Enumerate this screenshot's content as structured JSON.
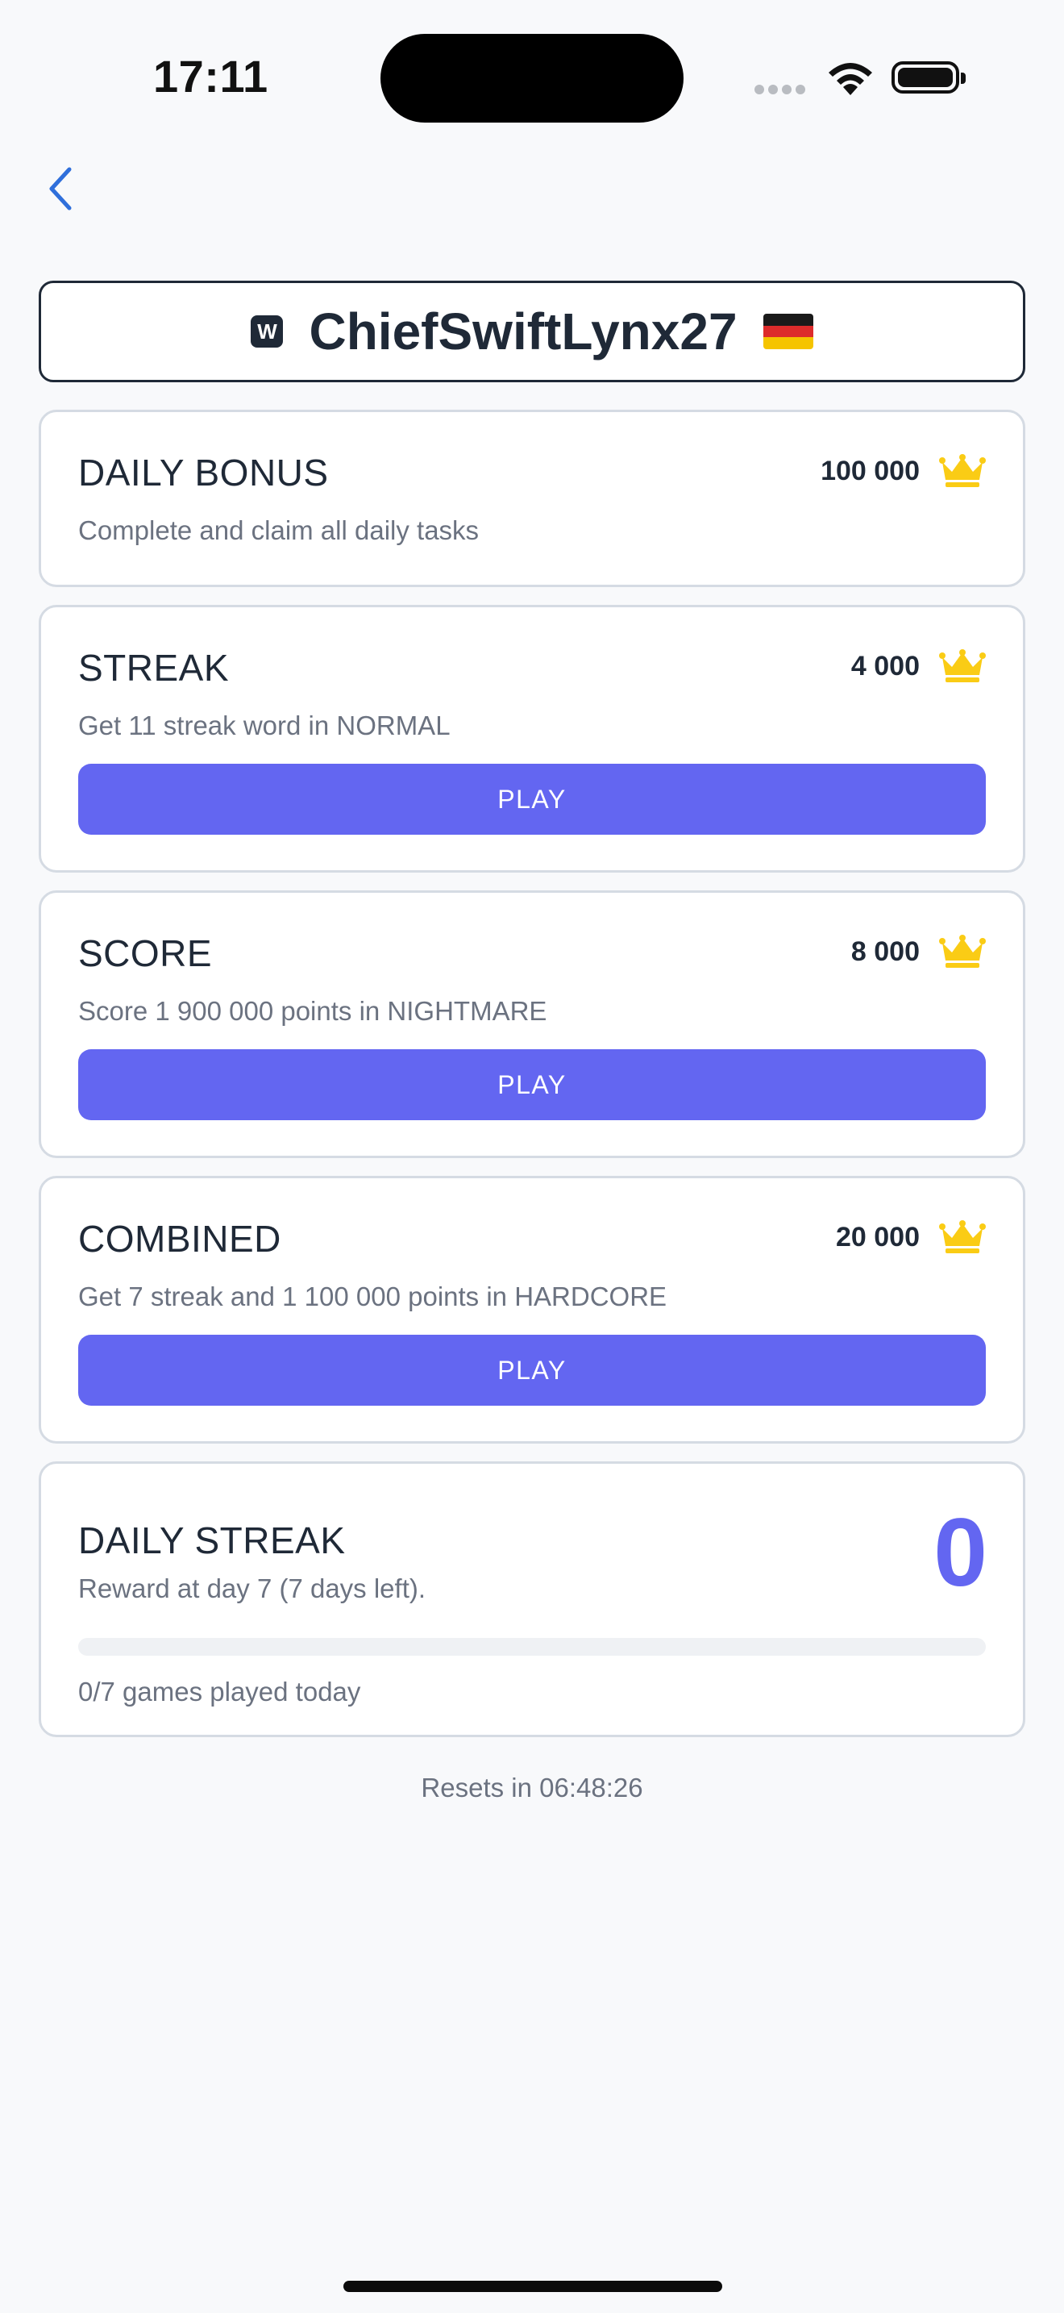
{
  "status_bar": {
    "time": "17:11"
  },
  "header": {
    "username": "ChiefSwiftLynx27",
    "logo_letter": "W",
    "flag": "germany-flag"
  },
  "tasks": [
    {
      "title": "DAILY BONUS",
      "reward": "100 000",
      "description": "Complete and claim all daily tasks"
    },
    {
      "title": "STREAK",
      "reward": "4 000",
      "description": "Get 11 streak word in NORMAL",
      "button": "PLAY"
    },
    {
      "title": "SCORE",
      "reward": "8 000",
      "description": "Score 1 900 000 points in NIGHTMARE",
      "button": "PLAY"
    },
    {
      "title": "COMBINED",
      "reward": "20 000",
      "description": "Get 7 streak and 1 100 000 points in HARDCORE",
      "button": "PLAY"
    }
  ],
  "daily_streak": {
    "title": "DAILY STREAK",
    "count": "0",
    "subtitle": "Reward at day 7 (7 days left).",
    "progress_fraction": 0,
    "games_played": "0/7 games played today"
  },
  "footer": {
    "resets": "Resets in 06:48:26"
  },
  "colors": {
    "accent": "#6366f1",
    "crown": "#facc15",
    "back_arrow": "#2f6fdb"
  }
}
